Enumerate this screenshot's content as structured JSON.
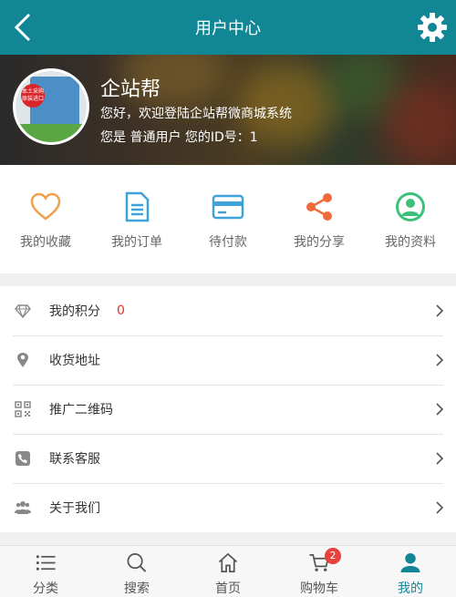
{
  "header": {
    "title": "用户中心",
    "back_icon": "chevron-left-icon",
    "settings_icon": "gear-icon"
  },
  "profile": {
    "name": "企站帮",
    "welcome": "您好，欢迎登陆企站帮微商城系统",
    "info": "您是 普通用户 您的ID号：1",
    "avatar_sticker": "本土采购 原装进口",
    "avatar_foot": "上品好货 健康宝贝"
  },
  "quick_links": [
    {
      "label": "我的收藏",
      "icon": "heart-icon",
      "color": "#f0a04b"
    },
    {
      "label": "我的订单",
      "icon": "document-icon",
      "color": "#3fa2d8"
    },
    {
      "label": "待付款",
      "icon": "card-icon",
      "color": "#3fa2d8"
    },
    {
      "label": "我的分享",
      "icon": "share-icon",
      "color": "#f06b3b"
    },
    {
      "label": "我的资料",
      "icon": "user-circle-icon",
      "color": "#3cc07a"
    }
  ],
  "menu": [
    {
      "label": "我的积分",
      "value": "0",
      "icon": "diamond-icon"
    },
    {
      "label": "收货地址",
      "icon": "location-pin-icon"
    },
    {
      "label": "推广二维码",
      "icon": "qrcode-icon"
    },
    {
      "label": "联系客服",
      "icon": "phone-icon"
    },
    {
      "label": "关于我们",
      "icon": "group-icon"
    }
  ],
  "tabbar": {
    "items": [
      {
        "label": "分类",
        "icon": "list-icon"
      },
      {
        "label": "搜索",
        "icon": "search-icon"
      },
      {
        "label": "首页",
        "icon": "home-icon"
      },
      {
        "label": "购物车",
        "icon": "cart-icon",
        "badge": "2"
      },
      {
        "label": "我的",
        "icon": "person-icon",
        "active": true
      }
    ]
  },
  "colors": {
    "primary": "#118796",
    "badge_red": "#e8413e",
    "points_red": "#e0312e"
  }
}
